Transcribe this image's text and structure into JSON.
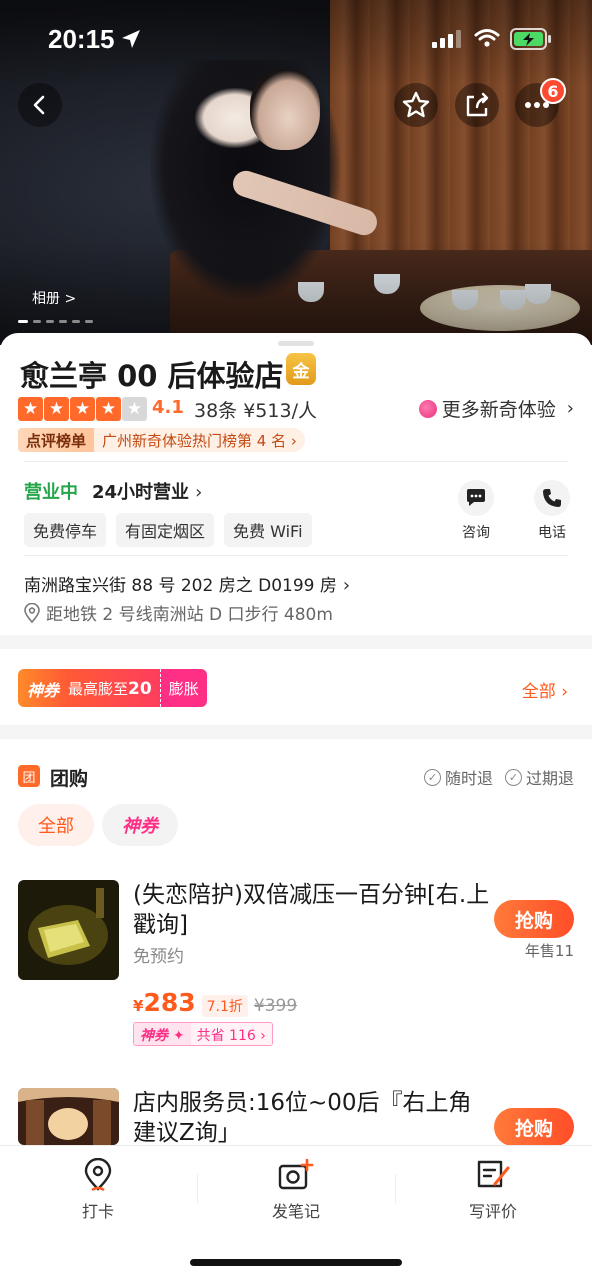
{
  "status_bar": {
    "time": "20:15"
  },
  "hero": {
    "album_label": "相册 >",
    "notification_count": "6"
  },
  "shop": {
    "name": "愈兰亭 00 后体验店",
    "level_badge": "金",
    "rating": "4.1",
    "rating_stars": 4.1,
    "reviews_and_price": "38条 ¥513/人",
    "more_experience": "更多新奇体验",
    "rank_tag": "点评榜单",
    "rank_text": "广州新奇体验热门榜第 4 名",
    "status": "营业中",
    "hours": "24小时营业",
    "tags": [
      "免费停车",
      "有固定烟区",
      "免费 WiFi"
    ],
    "consult_label": "咨询",
    "phone_label": "电话",
    "address": "南洲路宝兴街 88 号 202 房之 D0199 房",
    "distance": "距地铁 2 号线南洲站 D 口步行 480m"
  },
  "coupon": {
    "brand": "神券",
    "text": "最高膨至",
    "amount": "20",
    "expand": "膨胀",
    "all_link": "全部"
  },
  "group_buy": {
    "title": "团购",
    "guarantee_1": "随时退",
    "guarantee_2": "过期退",
    "filter_all": "全部",
    "filter_coupon": "神券",
    "deals": [
      {
        "title": "(失恋陪护)双倍减压一百分钟[右.上戳询]",
        "subtitle": "免预约",
        "button": "抢购",
        "sold": "年售11",
        "price": "283",
        "discount": "7.1折",
        "original": "¥399",
        "coupon_tag": "神券",
        "saving": "共省 116"
      },
      {
        "title": "店内服务员:16位~00后『右上角建议Z询」",
        "button": "抢购"
      }
    ]
  },
  "tabbar": {
    "checkin": "打卡",
    "note": "发笔记",
    "review": "写评价"
  },
  "colors": {
    "accent": "#ff5a1e",
    "open_green": "#25a54a",
    "pink": "#ff2f86"
  }
}
